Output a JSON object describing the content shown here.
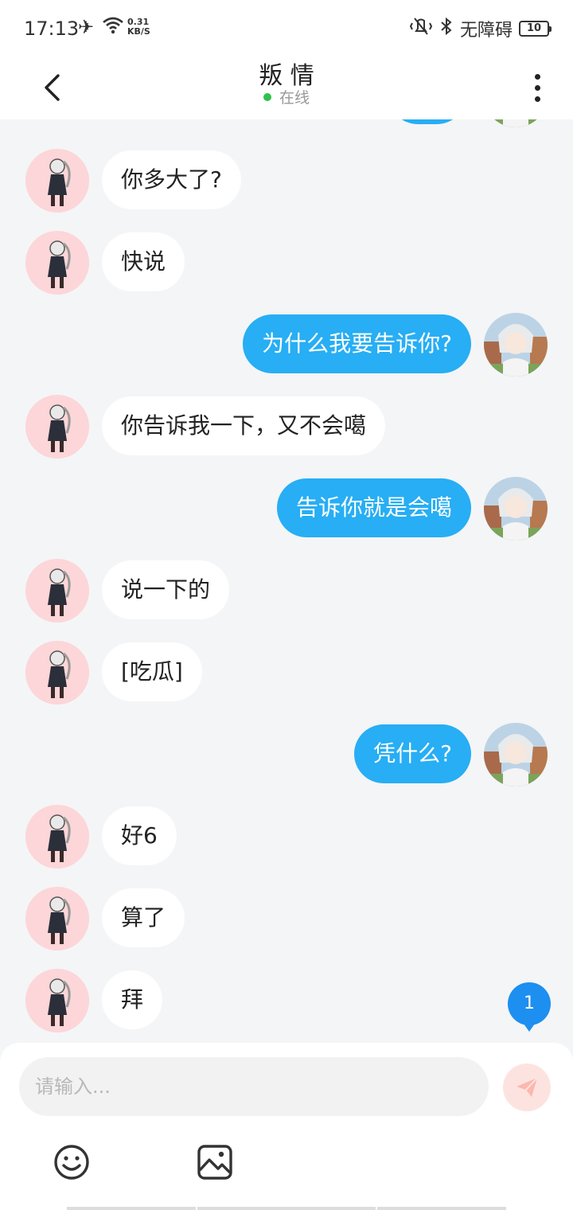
{
  "status_bar": {
    "time": "17:13",
    "speed_value": "0.31",
    "speed_unit": "KB/S",
    "accessibility": "无障碍",
    "battery": "10"
  },
  "header": {
    "title": "叛 情",
    "status": "在线"
  },
  "messages": [
    {
      "side": "left",
      "text": "你多大了?"
    },
    {
      "side": "left",
      "text": "快说"
    },
    {
      "side": "right",
      "text": "为什么我要告诉你?"
    },
    {
      "side": "left",
      "text": "你告诉我一下，又不会噶"
    },
    {
      "side": "right",
      "text": "告诉你就是会噶"
    },
    {
      "side": "left",
      "text": "说一下的"
    },
    {
      "side": "left",
      "text": "[吃瓜]"
    },
    {
      "side": "right",
      "text": "凭什么?"
    },
    {
      "side": "left",
      "text": "好6"
    },
    {
      "side": "left",
      "text": "算了"
    },
    {
      "side": "left",
      "text": "拜"
    }
  ],
  "unread_count": "1",
  "composer": {
    "placeholder": "请输入..."
  },
  "colors": {
    "accent": "#27aef4",
    "badge": "#1d8ff0",
    "online": "#2ec24a"
  }
}
